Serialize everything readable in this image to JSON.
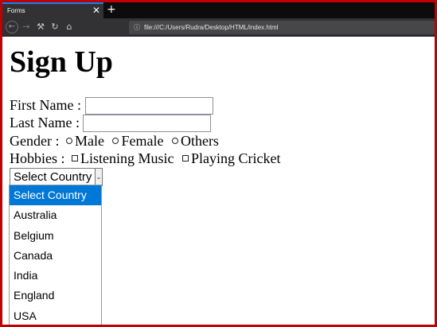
{
  "browser": {
    "tab_title": "Forms",
    "tab_close": "✕",
    "new_tab": "+",
    "url": "file:///C:/Users/Rudra/Desktop/HTML/index.html"
  },
  "page": {
    "heading": "Sign Up",
    "first_name_label": "First Name :",
    "last_name_label": "Last Name :",
    "gender_label": "Gender :",
    "gender_options": [
      "Male",
      "Female",
      "Others"
    ],
    "hobbies_label": "Hobbies :",
    "hobbies_options": [
      "Listening Music",
      "Playing Cricket"
    ],
    "country_select": {
      "value": "Select Country",
      "options": [
        "Select Country",
        "Australia",
        "Belgium",
        "Canada",
        "India",
        "England",
        "USA"
      ]
    }
  }
}
